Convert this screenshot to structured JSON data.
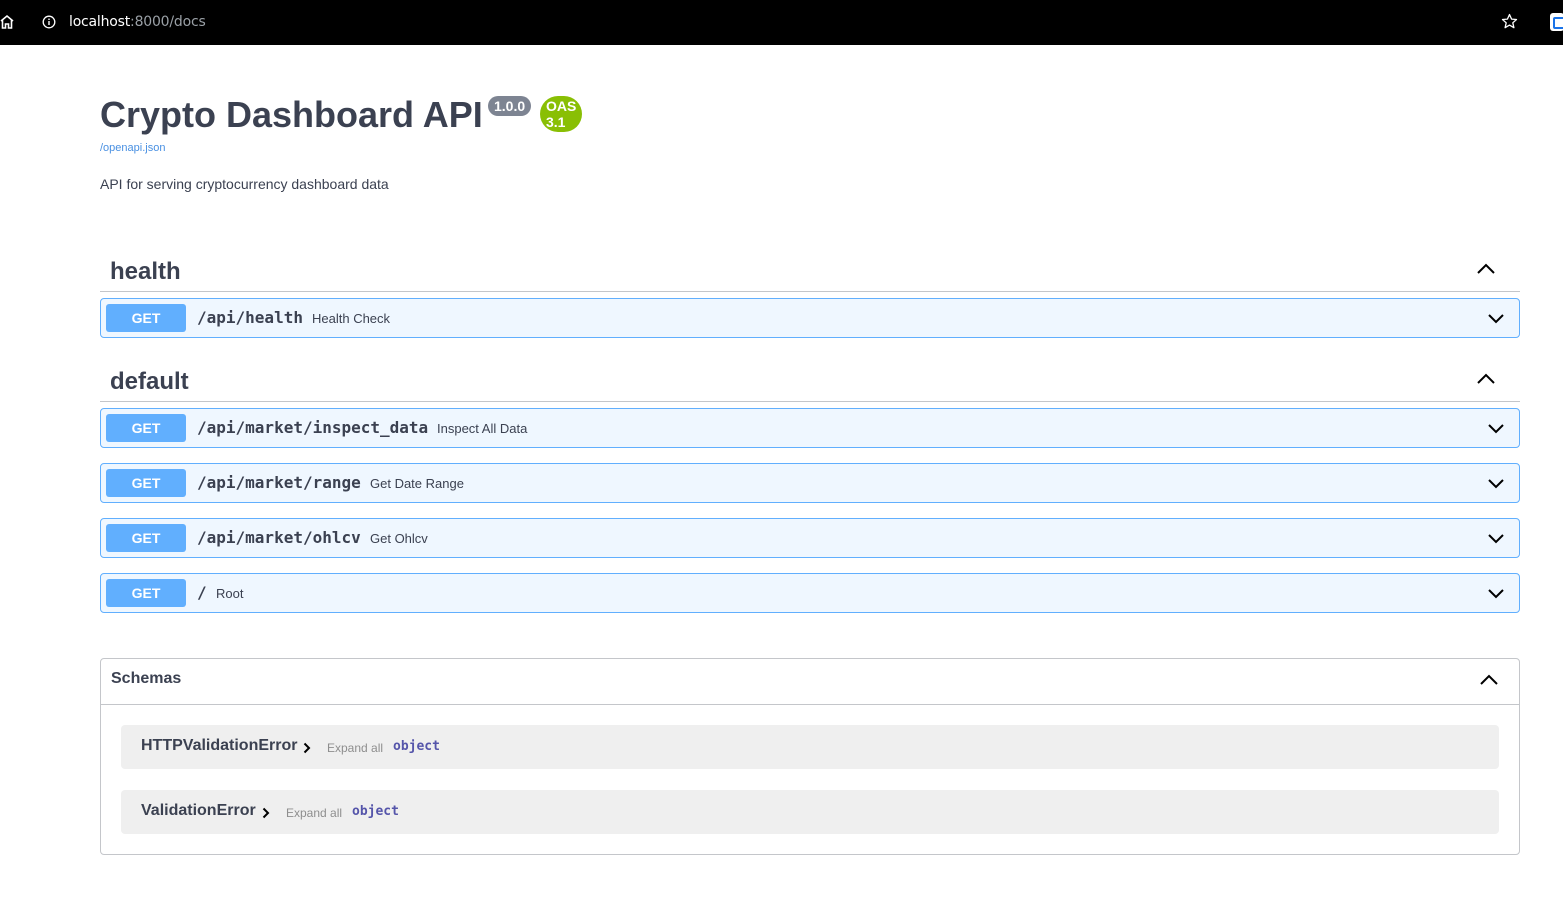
{
  "browser": {
    "url_host": "localhost",
    "url_path": ":8000/docs"
  },
  "info": {
    "title": "Crypto Dashboard API",
    "version": "1.0.0",
    "oas": "OAS 3.1",
    "spec_link": "/openapi.json",
    "description": "API for serving cryptocurrency dashboard data"
  },
  "tags": [
    {
      "name": "health",
      "operations": [
        {
          "method": "GET",
          "path": "/api/health",
          "summary": "Health Check"
        }
      ]
    },
    {
      "name": "default",
      "operations": [
        {
          "method": "GET",
          "path": "/api/market/inspect_data",
          "summary": "Inspect All Data"
        },
        {
          "method": "GET",
          "path": "/api/market/range",
          "summary": "Get Date Range"
        },
        {
          "method": "GET",
          "path": "/api/market/ohlcv",
          "summary": "Get Ohlcv"
        },
        {
          "method": "GET",
          "path": "/",
          "summary": "Root"
        }
      ]
    }
  ],
  "schemas": {
    "title": "Schemas",
    "models": [
      {
        "name": "HTTPValidationError",
        "expand": "Expand all",
        "type": "object"
      },
      {
        "name": "ValidationError",
        "expand": "Expand all",
        "type": "object"
      }
    ]
  },
  "colors": {
    "get": "#61afe0",
    "version_badge": "#7d8492",
    "oas_badge": "#89bf04",
    "link": "#4990e2"
  }
}
